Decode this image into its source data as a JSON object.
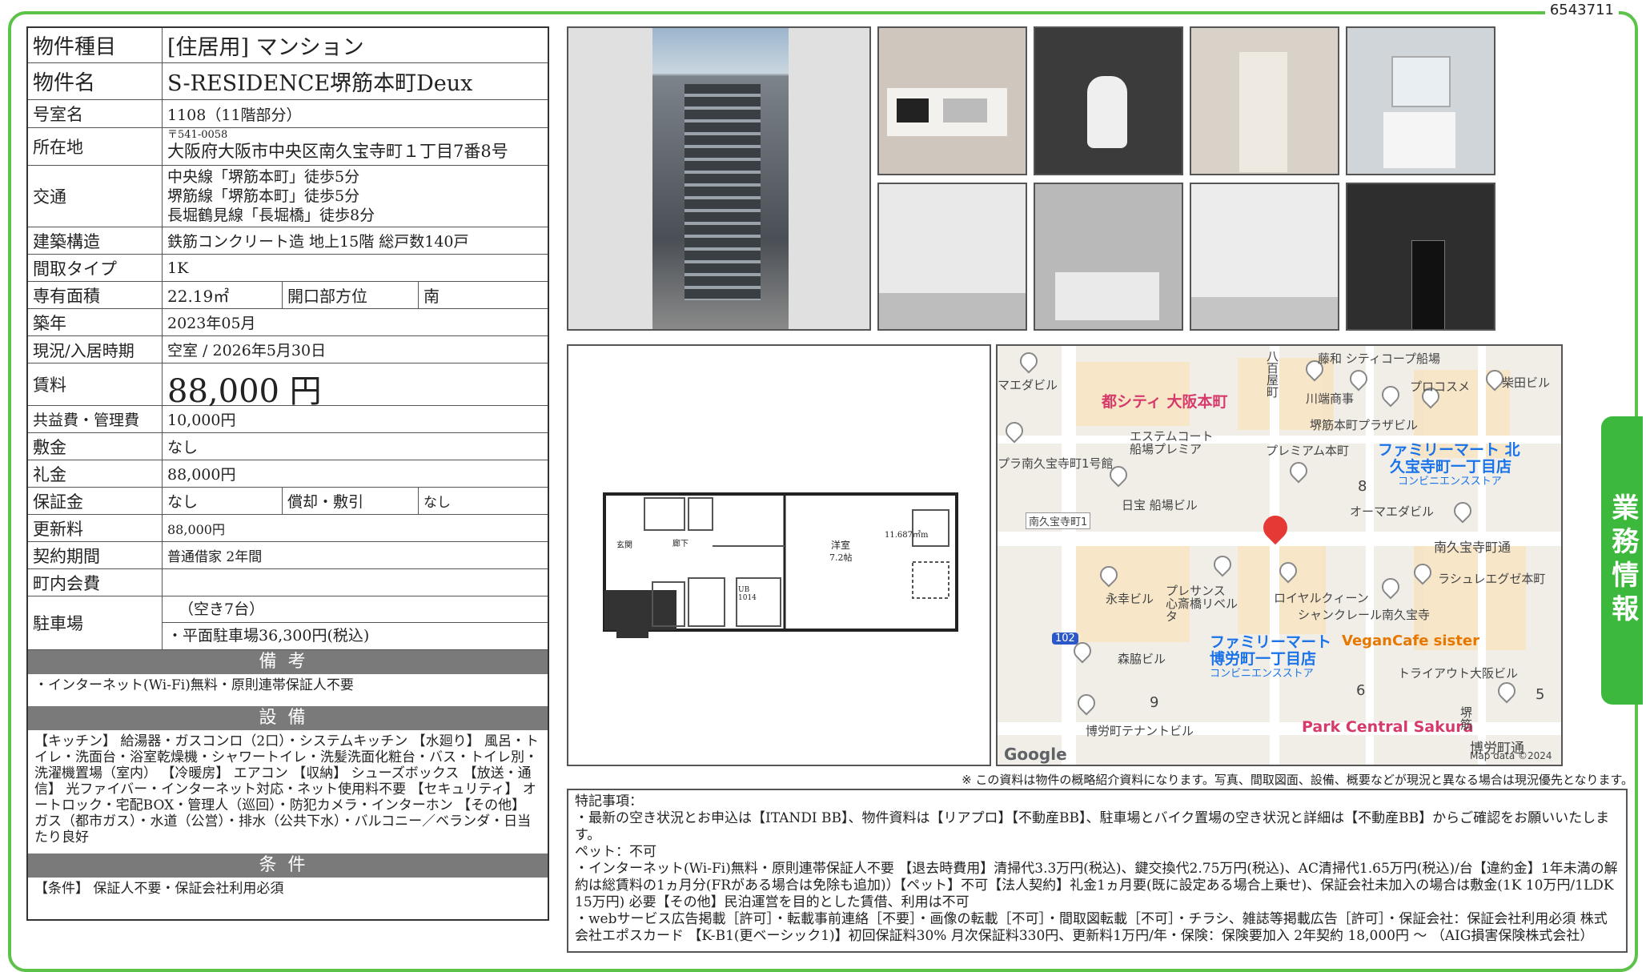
{
  "doc_id": "6543711",
  "side_tab": "業務情報",
  "property": {
    "type_label": "物件種目",
    "type_value": "[住居用] マンション",
    "name_label": "物件名",
    "name_value": "S-RESIDENCE堺筋本町Deux",
    "room_label": "号室名",
    "room_value": "1108（11階部分）",
    "addr_label": "所在地",
    "postal": "〒541-0058",
    "addr_value": "大阪府大阪市中央区南久宝寺町１丁目7番8号",
    "transit_label": "交通",
    "transit": [
      "中央線「堺筋本町」徒歩5分",
      "堺筋線「堺筋本町」徒歩5分",
      "長堀鶴見線「長堀橋」徒歩8分"
    ],
    "structure_label": "建築構造",
    "structure_value": "鉄筋コンクリート造 地上15階 総戸数140戸",
    "layout_label": "間取タイプ",
    "layout_value": "1K",
    "area_label": "専有面積",
    "area_value": "22.19㎡",
    "direction_label": "開口部方位",
    "direction_value": "南",
    "built_label": "築年",
    "built_value": "2023年05月",
    "status_label": "現況/入居時期",
    "status_value": "空室 /  2026年5月30日",
    "rent_label": "賃料",
    "rent_value": "88,000 円",
    "mgmt_label": "共益費・管理費",
    "mgmt_value": "10,000円",
    "deposit_label": "敷金",
    "deposit_value": "なし",
    "keymoney_label": "礼金",
    "keymoney_value": "88,000円",
    "guarantee_label": "保証金",
    "guarantee_value": "なし",
    "amort_label": "償却・敷引",
    "amort_value": "なし",
    "renewal_label": "更新料",
    "renewal_value": "88,000円",
    "contract_label": "契約期間",
    "contract_value": "普通借家 2年間",
    "assoc_label": "町内会費",
    "assoc_value": "",
    "parking_label": "駐車場",
    "parking_value1": "（空き7台）",
    "parking_value2": "・平面駐車場36,300円(税込)"
  },
  "remarks": {
    "title": "備考",
    "body": "・インターネット(Wi-Fi)無料・原則連帯保証人不要"
  },
  "equipment": {
    "title": "設備",
    "body": "【キッチン】 給湯器・ガスコンロ（2口）・システムキッチン 【水廻り】 風呂・トイレ・洗面台・浴室乾燥機・シャワートイレ・洗髪洗面化粧台・バス・トイレ別・洗濯機置場（室内） 【冷暖房】 エアコン 【収納】 シューズボックス 【放送・通信】 光ファイバー・インターネット対応・ネット使用料不要 【セキュリティ】 オートロック・宅配BOX・管理人（巡回）・防犯カメラ・インターホン 【その他】 ガス（都市ガス）・水道（公営）・排水（公共下水）・バルコニー／ベランダ・日当たり良好"
  },
  "conditions": {
    "title": "条件",
    "body": "【条件】 保証人不要・保証会社利用必須"
  },
  "floorplan": {
    "room": "洋室",
    "size": "7.2帖",
    "dim": "11.687㎡m",
    "entrance": "玄関",
    "hall": "廊下",
    "ub": "UB 1014"
  },
  "map": {
    "labels": [
      "マエダビル",
      "都シティ 大阪本町",
      "藤和 シティコープ船場",
      "川端商事",
      "プロコスメ",
      "柴田ビル",
      "堺筋本町プラザビル",
      "エステムコート 船場プレミア",
      "プレミアム本町",
      "ファミリーマート 北",
      "久宝寺町一丁目店",
      "コンビニエンスストア",
      "プラ南久宝寺町1号館",
      "日宝 船場ビル",
      "オーマエダビル",
      "南久宝寺町1",
      "南久宝寺町通",
      "永幸ビル",
      "プレサンス 心斎橋リベルタ",
      "ロイヤルクィーン",
      "シャンクレール南久宝寺",
      "ラシュレエグゼ本町",
      "ファミリーマート",
      "博労町一丁目店",
      "コンビニエンスストア",
      "VeganCafe sister",
      "森脇ビル",
      "トライアウト大阪ビル",
      "Park Central Sakura",
      "博労町テナントビル",
      "博労町通",
      "堺筋",
      "八百屋町",
      "102",
      "8",
      "9",
      "6",
      "5"
    ],
    "google": "Google",
    "attribution": "Map data ©2024"
  },
  "disclaimer": "※ この資料は物件の概略紹介資料になります。写真、間取図面、設備、概要などが現況と異なる場合は現況優先となります。",
  "special": {
    "lines": [
      "特記事項：",
      "・最新の空き状況とお申込は【ITANDI BB】、物件資料は【リアプロ】【不動産BB】、駐車場とバイク置場の空き状況と詳細は【不動産BB】からご確認をお願いいたします。",
      "ペット：不可",
      "・インターネット(Wi-Fi)無料・原則連帯保証人不要 【退去時費用】清掃代3.3万円(税込)、鍵交換代2.75万円(税込)、AC清掃代1.65万円(税込)/台【違約金】1年未満の解約は総賃料の1ヵ月分(FRがある場合は免除も追加)）【ペット】不可【法人契約】礼金1ヵ月要(既に設定ある場合上乗せ)、保証会社未加入の場合は敷金(1K 10万円/1LDK 15万円) 必要【その他】民泊運営を目的とした賃借、利用は不可",
      "・webサービス広告掲載［許可］・転載事前連絡［不要］・画像の転載［不可］・間取図転載［不可］・チラシ、雑誌等掲載広告［許可］・保証会社：保証会社利用必須 株式会社エポスカード 【K-B1(更ベーシック1)】初回保証料30% 月次保証料330円、更新料1万円/年・保険：保険要加入 2年契約 18,000円 〜 （AIG損害保険株式会社）"
    ]
  },
  "colors": {
    "frame": "#5cc24a",
    "section_header": "#7a7a7a",
    "map_blue": "#1a73e8",
    "map_pink": "#d63a6a"
  }
}
